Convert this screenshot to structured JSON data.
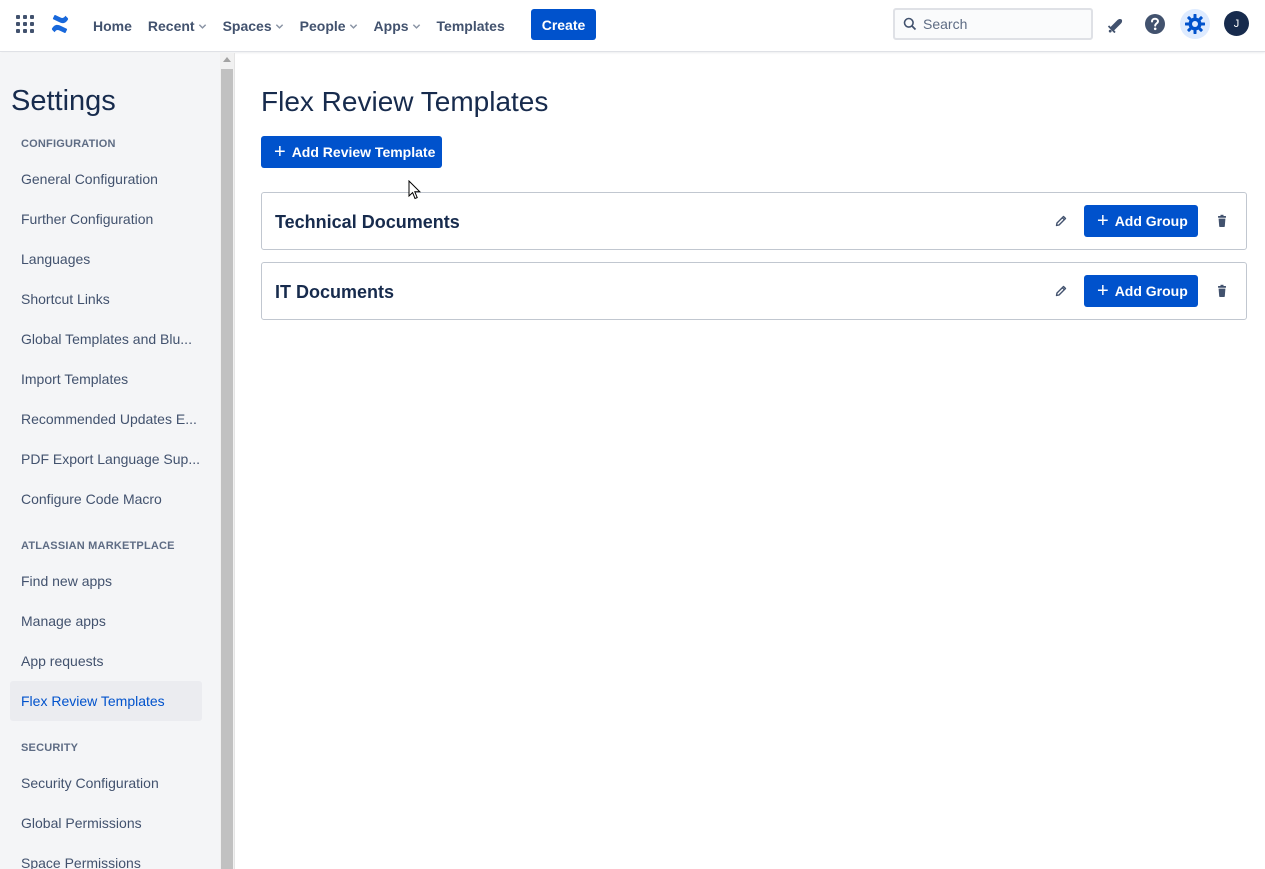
{
  "topnav": {
    "app_switcher_icon": "grid-icon",
    "logo_icon": "confluence-logo-icon",
    "items": [
      {
        "label": "Home",
        "dropdown": false
      },
      {
        "label": "Recent",
        "dropdown": true
      },
      {
        "label": "Spaces",
        "dropdown": true
      },
      {
        "label": "People",
        "dropdown": true
      },
      {
        "label": "Apps",
        "dropdown": true
      },
      {
        "label": "Templates",
        "dropdown": false
      }
    ],
    "create_label": "Create",
    "search_placeholder": "Search",
    "avatar_initial": "J",
    "accent": "#0052cc"
  },
  "sidebar": {
    "title": "Settings",
    "sections": [
      {
        "heading": "CONFIGURATION",
        "items": [
          "General Configuration",
          "Further Configuration",
          "Languages",
          "Shortcut Links",
          "Global Templates and Blu...",
          "Import Templates",
          "Recommended Updates E...",
          "PDF Export Language Sup...",
          "Configure Code Macro"
        ]
      },
      {
        "heading": "ATLASSIAN MARKETPLACE",
        "items": [
          "Find new apps",
          "Manage apps",
          "App requests",
          "Flex Review Templates"
        ]
      },
      {
        "heading": "SECURITY",
        "items": [
          "Security Configuration",
          "Global Permissions",
          "Space Permissions"
        ]
      }
    ],
    "active_item": "Flex Review Templates"
  },
  "main": {
    "title": "Flex Review Templates",
    "add_template_label": "Add Review Template",
    "templates": [
      {
        "name": "Technical Documents",
        "add_group_label": "Add Group"
      },
      {
        "name": "IT Documents",
        "add_group_label": "Add Group"
      }
    ]
  }
}
